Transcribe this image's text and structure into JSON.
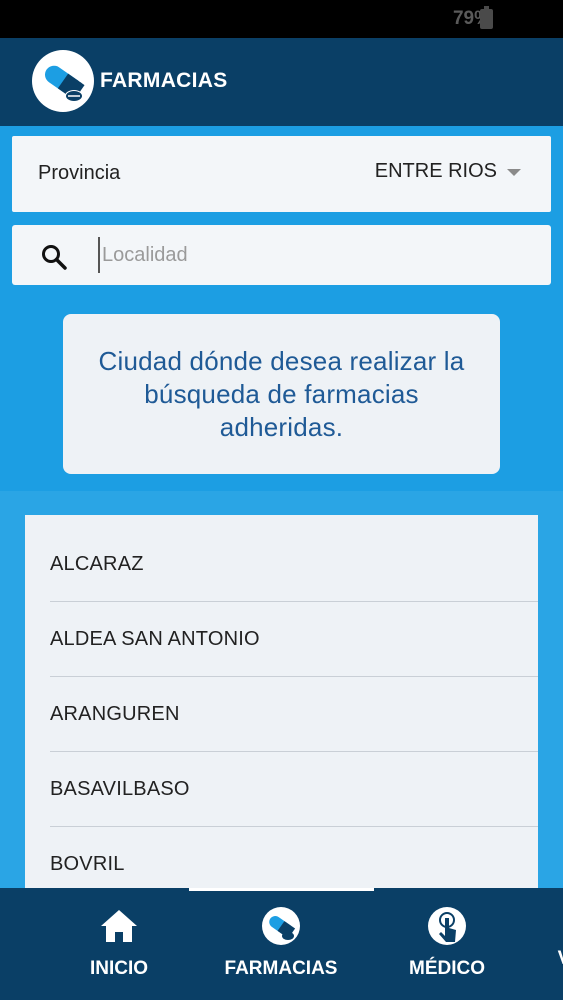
{
  "status_bar": {
    "battery_percent": "79%"
  },
  "header": {
    "title": "FARMACIAS",
    "logo_icon": "pill-capsule-icon"
  },
  "province": {
    "label": "Provincia",
    "selected": "ENTRE RIOS"
  },
  "search": {
    "placeholder": "Localidad",
    "value": "",
    "icon": "search-icon"
  },
  "info": {
    "text": "Ciudad dónde desea realizar la búsqueda de farmacias adheridas."
  },
  "localities": [
    "ALCARAZ",
    "ALDEA SAN ANTONIO",
    "ARANGUREN",
    "BASAVILBASO",
    "BOVRIL"
  ],
  "bottom_nav": {
    "items": [
      {
        "label": "INICIO",
        "icon": "home-icon"
      },
      {
        "label": "FARMACIAS",
        "icon": "pill-capsule-icon",
        "active": true
      },
      {
        "label": "MÉDICO",
        "icon": "touch-hand-icon"
      },
      {
        "label": "V",
        "icon": ""
      }
    ]
  },
  "colors": {
    "header_bg": "#0a3f66",
    "band_bg": "#1c9ee3",
    "info_text": "#1f5a96",
    "card_bg": "#eef2f6"
  }
}
